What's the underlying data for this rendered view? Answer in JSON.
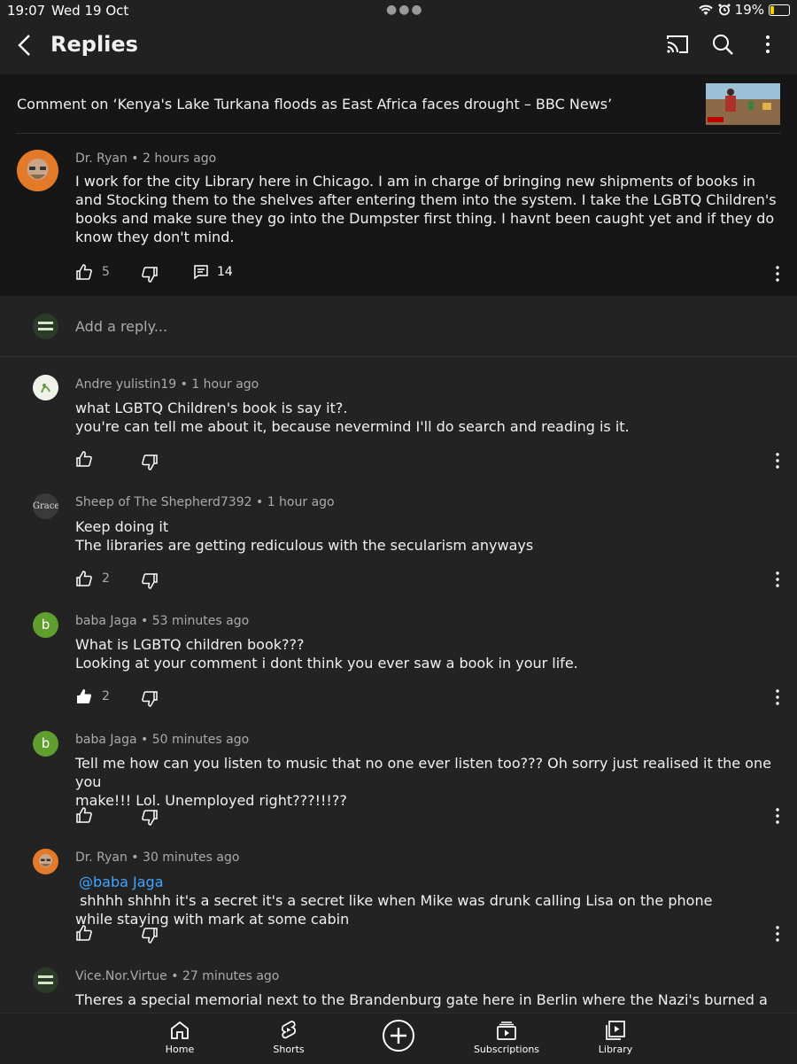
{
  "status": {
    "time": "19:07",
    "date": "Wed 19 Oct",
    "battery": "19%"
  },
  "appbar": {
    "title": "Replies"
  },
  "video": {
    "header": "Comment on ‘Kenya's Lake Turkana floods as East Africa faces drought – BBC News’"
  },
  "parent": {
    "author": "Dr. Ryan",
    "time": "2 hours ago",
    "text": "I work for the city Library here in Chicago. I am in charge of bringing new shipments of books in and Stocking them to the shelves after entering them into the system. I take the LGBTQ Children's books and make sure they go into the Dumpster first thing. I havnt been caught yet and if they do know they don't mind.",
    "likes": "5",
    "replies": "14"
  },
  "reply_box": {
    "placeholder": "Add a reply..."
  },
  "replies": [
    {
      "author": "Andre yulistin19",
      "time": "1 hour ago",
      "lines": [
        "what LGBTQ Children's book is say it?.",
        "you're can tell me about it, because nevermind I'll do search and reading is it."
      ],
      "likes": ""
    },
    {
      "author": "Sheep of The Shepherd7392",
      "time": "1 hour ago",
      "lines": [
        "Keep doing it",
        "The libraries are getting rediculous with the secularism anyways"
      ],
      "likes": "2"
    },
    {
      "author": "baba Jaga",
      "time": "53 minutes ago",
      "lines": [
        "What is LGBTQ children book???",
        "Looking at your comment i dont think you ever saw a book in your life."
      ],
      "likes": "2",
      "avatar_letter": "b"
    },
    {
      "author": "baba Jaga",
      "time": "50 minutes ago",
      "lines": [
        "Tell me how can you listen to music that no one ever listen too??? Oh sorry just realised it the one you",
        "make!!! Lol. Unemployed right???!!!??"
      ],
      "likes": "",
      "avatar_letter": "b"
    },
    {
      "author": "Dr. Ryan",
      "time": "30 minutes ago",
      "mention": "@baba Jaga",
      "lines": [
        " shhhh shhhh it's a secret it's a secret like when Mike was drunk calling Lisa on the phone",
        "while staying with mark at some cabin"
      ],
      "likes": ""
    },
    {
      "author": "Vice.Nor.Virtue",
      "time": "27 minutes ago",
      "lines": [
        "Theres a special memorial next to the Brandenburg gate here in Berlin where the Nazi's burned a great"
      ],
      "likes": ""
    }
  ],
  "sheep_avatar_text": "Grace",
  "nav": {
    "home": "Home",
    "shorts": "Shorts",
    "subscriptions": "Subscriptions",
    "library": "Library"
  },
  "colors": {
    "background": "#232323",
    "header": "#161616",
    "mention": "#3ea6ff",
    "avatar_green": "#5f9e2f",
    "battery": "#f5d000"
  }
}
